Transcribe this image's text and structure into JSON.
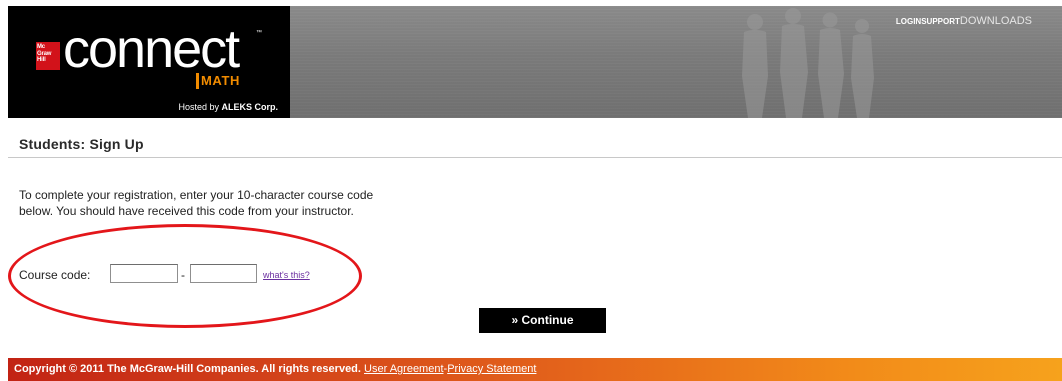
{
  "header": {
    "brand_box": "Mc Graw Hill",
    "logo_word": "connect",
    "logo_tm": "™",
    "product": "MATH",
    "hosted_prefix": "Hosted by ",
    "hosted_company": "ALEKS Corp.",
    "nav": {
      "login": "LOGIN",
      "support": "SUPPORT",
      "downloads": "DOWNLOADS"
    }
  },
  "page": {
    "title": "Students: Sign Up",
    "instructions": "To complete your registration, enter your 10-character course code below. You should have received this code from your instructor.",
    "course_code_label": "Course code:",
    "code_part1_value": "",
    "code_part2_value": "",
    "separator": "-",
    "whats_this": "what's this?",
    "continue_label": "» Continue"
  },
  "footer": {
    "copyright": "Copyright © 2011 The McGraw-Hill Companies. All rights reserved.",
    "user_agreement": "User Agreement",
    "separator": "-",
    "privacy": "Privacy Statement"
  },
  "colors": {
    "accent_orange": "#f28c00",
    "brand_red": "#d2121a",
    "annotation_red": "#e3161a",
    "link_purple": "#6b2fa0"
  }
}
